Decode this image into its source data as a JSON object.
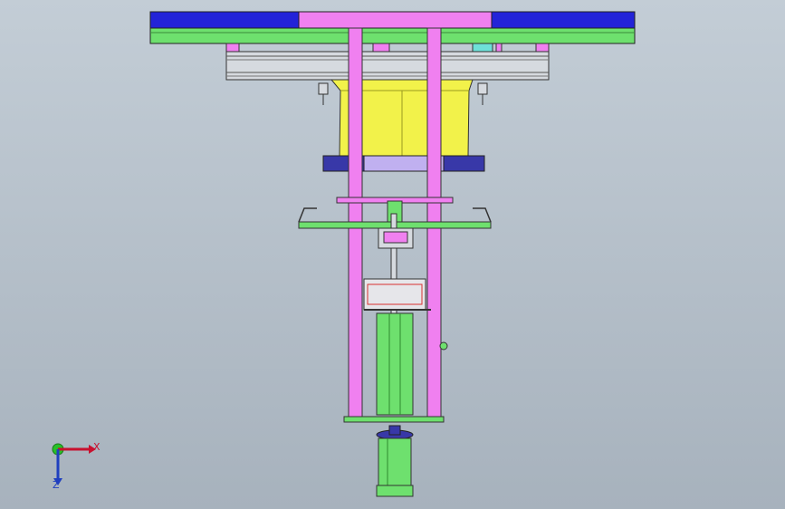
{
  "viewport": {
    "background_top": "#c3cdd6",
    "background_bottom": "#a7b2bd"
  },
  "colors": {
    "blue": "#2323d8",
    "magenta": "#f080f0",
    "green": "#6ee06e",
    "yellow": "#f2f24a",
    "navy": "#3838a8",
    "grey": "#d6dadf",
    "outline": "#333333"
  },
  "triad": {
    "x_label": "X",
    "y_label": "Z",
    "x_color": "#c8102e",
    "y_color": "#1f3fbf",
    "origin_color": "#27c027"
  }
}
